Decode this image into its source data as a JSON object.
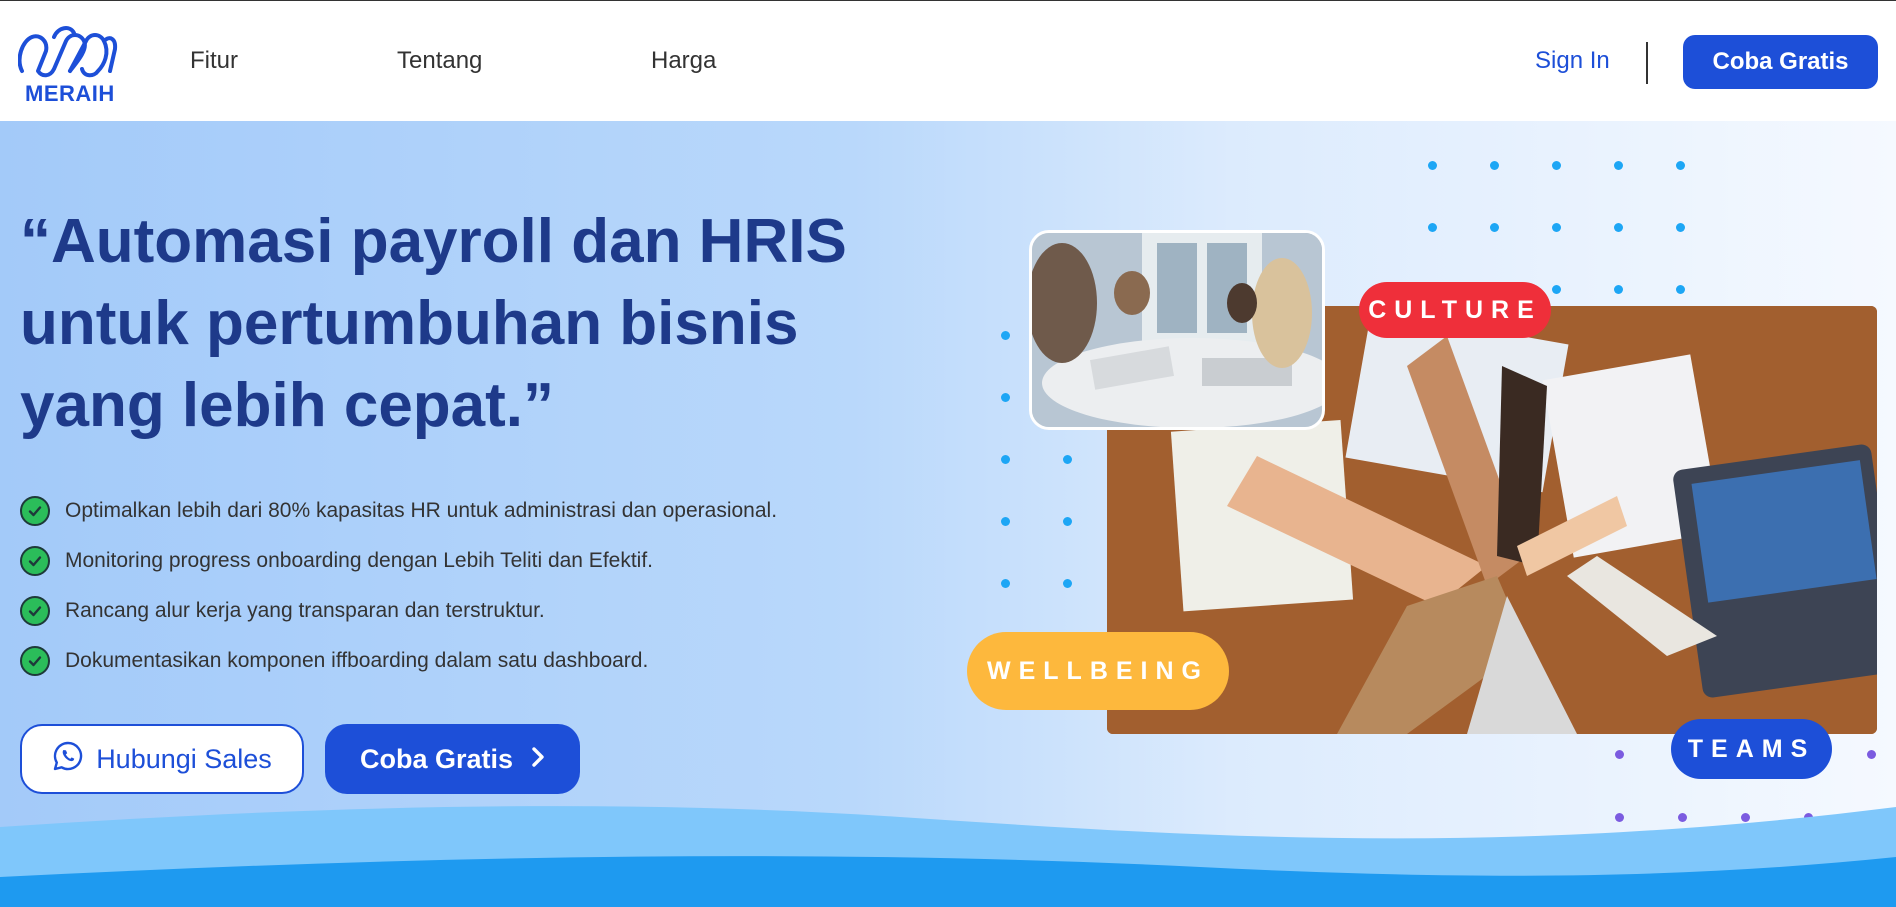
{
  "brand": {
    "name": "MERAIH",
    "color": "#1d4fd8"
  },
  "nav": {
    "links": [
      "Fitur",
      "Tentang",
      "Harga"
    ],
    "sign_in": "Sign In",
    "cta": "Coba Gratis"
  },
  "hero": {
    "headline_lines": [
      "“Automasi payroll dan HRIS",
      "untuk pertumbuhan bisnis",
      "yang lebih cepat.”"
    ],
    "benefits": [
      "Optimalkan lebih dari 80% kapasitas HR untuk administrasi dan operasional.",
      "Monitoring progress onboarding dengan Lebih Teliti dan Efektif.",
      "Rancang alur kerja yang transparan dan terstruktur.",
      "Dokumentasikan komponen iffboarding dalam satu dashboard."
    ],
    "buttons": {
      "sales": "Hubungi Sales",
      "trial": "Coba Gratis"
    },
    "tags": {
      "culture": "CULTURE",
      "wellbeing": "WELLBEING",
      "teams": "TEAMS"
    }
  },
  "colors": {
    "primary": "#1d4fd8",
    "headline": "#1e3a8a",
    "check": "#2bbd5a",
    "culture": "#ef2f3a",
    "wellbeing": "#fdb83d",
    "dot_blue": "#1da6f5",
    "dot_purple": "#7b5be0"
  },
  "icons": {
    "check": "check-circle-icon",
    "whatsapp": "whatsapp-icon",
    "chevron": "chevron-right-icon"
  }
}
